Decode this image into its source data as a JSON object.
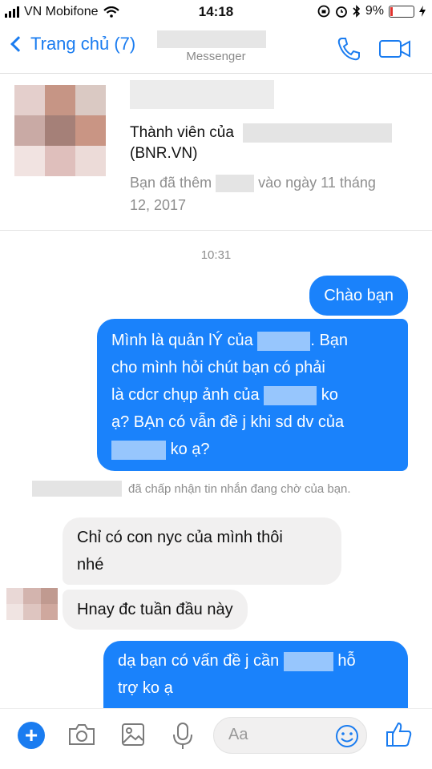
{
  "status_bar": {
    "carrier": "VN Mobifone",
    "time": "14:18",
    "battery": "9%"
  },
  "header": {
    "back_label": "Trang chủ (7)",
    "subtitle": "Messenger"
  },
  "group_info": {
    "member_line_1": "Thành viên của",
    "member_line_2": "(BNR.VN)",
    "added_prefix": "Bạn đã thêm",
    "added_suffix": "vào ngày 11 tháng",
    "added_line_2": "12, 2017"
  },
  "conversation": {
    "timestamp": "10:31",
    "msg1": "Chào bạn",
    "msg2_l1a": "Mình là quản lÝ của",
    "msg2_l1b": ". Bạn",
    "msg2_l2": "cho mình hỏi chút bạn có phải",
    "msg2_l3a": "là cdcr chụp ảnh của",
    "msg2_l3b": "ko",
    "msg2_l4": "ạ? BẠn có vẫn đề j khi sd dv của",
    "msg2_l5b": "ko ạ?",
    "system_msg": "đã chấp nhận tin nhắn đang chờ của bạn.",
    "msg3_l1": "Chỉ có con nyc của mình thôi",
    "msg3_l2": "nhé",
    "msg4": "Hnay đc tuần đầu này",
    "msg5_l1a": "dạ bạn có vấn đề j cần",
    "msg5_l1b": "hỗ",
    "msg5_l2": "trợ ko ạ"
  },
  "composer": {
    "placeholder": "Aa"
  },
  "colors": {
    "accent": "#1a7cf0",
    "outgoing_bubble": "#1a82fb",
    "incoming_bubble": "#f1f0f0"
  }
}
